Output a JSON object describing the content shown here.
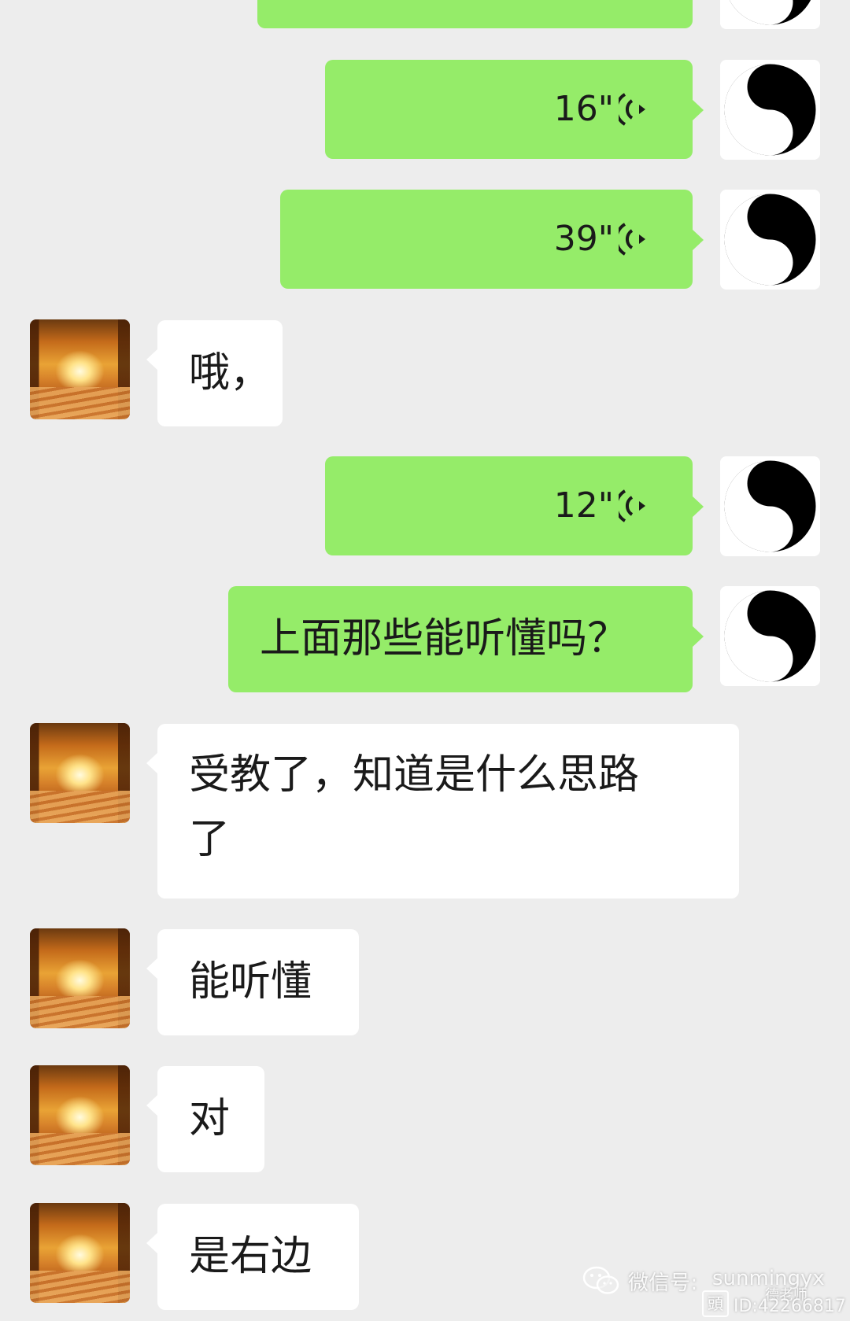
{
  "chat": {
    "messages": [
      {
        "side": "right",
        "type": "voice",
        "duration": ""
      },
      {
        "side": "right",
        "type": "voice",
        "duration": "16\""
      },
      {
        "side": "right",
        "type": "voice",
        "duration": "39\""
      },
      {
        "side": "left",
        "type": "text",
        "text": "哦，"
      },
      {
        "side": "right",
        "type": "voice",
        "duration": "12\""
      },
      {
        "side": "right",
        "type": "text",
        "text": "上面那些能听懂吗？"
      },
      {
        "side": "left",
        "type": "text",
        "text": "受教了，知道是什么思路了"
      },
      {
        "side": "left",
        "type": "text",
        "text": "能听懂"
      },
      {
        "side": "left",
        "type": "text",
        "text": "对"
      },
      {
        "side": "left",
        "type": "text",
        "text": "是右边"
      }
    ]
  },
  "watermark": {
    "label": "微信号:",
    "account": "sunmingyx",
    "author": "德老师",
    "id": "ID:42266817"
  },
  "colors": {
    "background": "#ededed",
    "self_bubble": "#95ec69",
    "other_bubble": "#ffffff",
    "text": "#1a1a1a"
  },
  "icons": {
    "self_avatar": "yin-yang-icon",
    "other_avatar": "autumn-forest-avatar",
    "voice": "voice-wave-icon",
    "wechat": "wechat-icon"
  }
}
